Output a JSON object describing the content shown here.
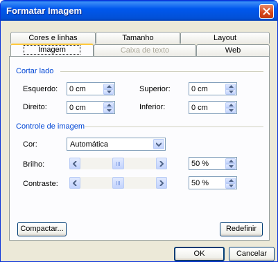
{
  "window": {
    "title": "Formatar Imagem"
  },
  "tabs": {
    "row1": [
      "Cores e linhas",
      "Tamanho",
      "Layout"
    ],
    "row2": [
      "Imagem",
      "Caixa de texto",
      "Web"
    ]
  },
  "crop": {
    "group_label": "Cortar lado",
    "left_label": "Esquerdo:",
    "left_value": "0 cm",
    "top_label": "Superior:",
    "top_value": "0 cm",
    "right_label": "Direito:",
    "right_value": "0 cm",
    "bottom_label": "Inferior:",
    "bottom_value": "0 cm"
  },
  "image_control": {
    "group_label": "Controle de imagem",
    "color_label": "Cor:",
    "color_value": "Automática",
    "brightness_label": "Brilho:",
    "brightness_value": "50 %",
    "brightness_level": 0.5,
    "contrast_label": "Contraste:",
    "contrast_value": "50 %",
    "contrast_level": 0.5
  },
  "buttons": {
    "compress": "Compactar...",
    "reset": "Redefinir",
    "ok": "OK",
    "cancel": "Cancelar"
  }
}
